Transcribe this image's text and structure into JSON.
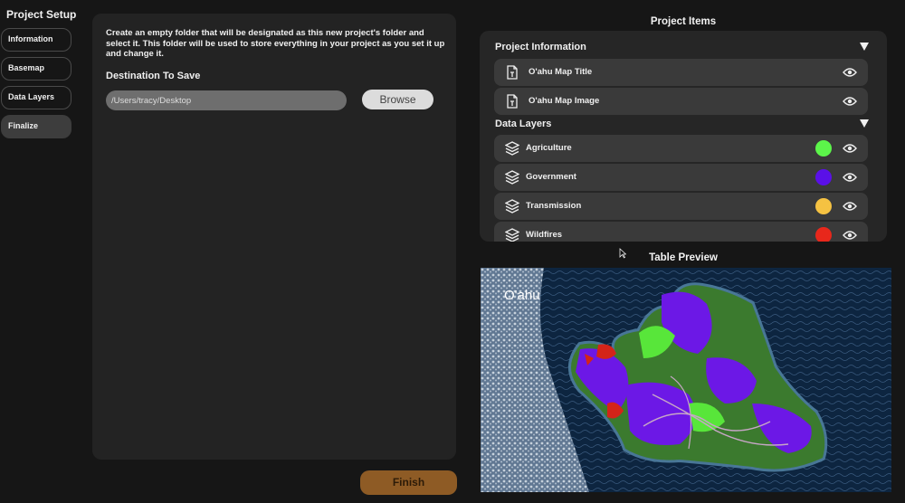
{
  "sidebar": {
    "title": "Project Setup",
    "items": [
      {
        "label": "Information"
      },
      {
        "label": "Basemap"
      },
      {
        "label": "Data Layers"
      },
      {
        "label": "Finalize"
      }
    ]
  },
  "main": {
    "instructions": "Create an empty folder that will be designated as this new project's folder and select it. This folder will be used to store everything in your project as you set it up and change it.",
    "destination_label": "Destination To Save",
    "destination_value": "/Users/tracy/Desktop",
    "browse_label": "Browse",
    "finish_label": "Finish"
  },
  "project_items": {
    "title": "Project Items",
    "information_header": "Project Information",
    "information_items": [
      {
        "label": "O'ahu Map Title",
        "icon": "document-icon"
      },
      {
        "label": "O'ahu Map Image",
        "icon": "document-icon"
      }
    ],
    "layers_header": "Data Layers",
    "layers": [
      {
        "label": "Agriculture",
        "color": "#5cf54a",
        "icon": "layers-icon"
      },
      {
        "label": "Government",
        "color": "#5a10e8",
        "icon": "layers-icon"
      },
      {
        "label": "Transmission",
        "color": "#f5c242",
        "icon": "layers-icon"
      },
      {
        "label": "Wildfires",
        "color": "#e8271b",
        "icon": "layers-icon"
      }
    ]
  },
  "preview": {
    "title": "Table Preview",
    "map_label": "O'ahu"
  }
}
